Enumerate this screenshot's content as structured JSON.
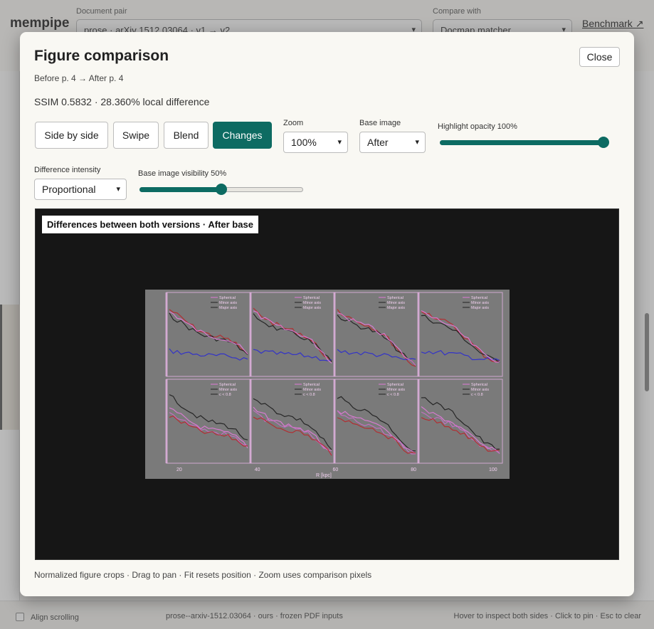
{
  "app": {
    "brand": "mempipe",
    "document_pair_label": "Document pair",
    "document_pair_value": "prose · arXiv 1512.03064 · v1 → v2",
    "compare_with_label": "Compare with",
    "compare_with_value": "Docmap matcher",
    "benchmark_link": "Benchmark ↗",
    "bottom": {
      "align_scrolling": "Align scrolling",
      "center_text": "prose--arxiv-1512.03064 · ours · frozen PDF inputs",
      "right_text": "Hover to inspect both sides · Click to pin · Esc to clear"
    }
  },
  "modal": {
    "title": "Figure comparison",
    "close_label": "Close",
    "pages": "Before p. 4 → After p. 4",
    "ssim": "SSIM 0.5832 · 28.360% local difference",
    "mode_buttons": [
      "Side by side",
      "Swipe",
      "Blend",
      "Changes"
    ],
    "active_mode": "Changes",
    "zoom": {
      "label": "Zoom",
      "value": "100%"
    },
    "base_image": {
      "label": "Base image",
      "value": "After"
    },
    "highlight_opacity": {
      "label": "Highlight opacity 100%",
      "value": 1.0
    },
    "difference_intensity": {
      "label": "Difference intensity",
      "value": "Proportional"
    },
    "base_visibility": {
      "label": "Base image visibility 50%",
      "value": 0.5
    },
    "viewer_tag": "Differences between both versions · After base",
    "footer": "Normalized figure crops · Drag to pan · Fit resets position · Zoom uses comparison pixels"
  },
  "figure": {
    "top_legend": [
      "Spherical",
      "Minor axis",
      "Major axis"
    ],
    "bottom_legend": [
      "Spherical",
      "Minor axis",
      "c < 0.8",
      "c < 0.7",
      "c < 0.55",
      "All"
    ],
    "x_ticks": [
      "20",
      "40",
      "60",
      "80",
      "100"
    ],
    "x_label": "R [kpc]",
    "colors": {
      "accent": "#0d6b62",
      "diff_magenta": "#e07bd8",
      "diff_red": "#b8262a",
      "diff_blue": "#2b2bd0"
    }
  }
}
